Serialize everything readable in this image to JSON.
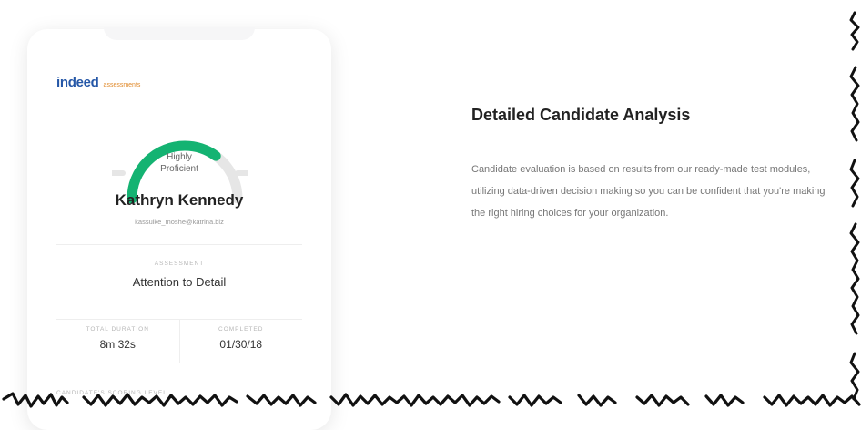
{
  "card": {
    "logo_brand": "indeed",
    "logo_sub": "assessments",
    "gauge_line1": "Highly",
    "gauge_line2": "Proficient",
    "gauge_level": 0.7,
    "gauge_color": "#14b372",
    "candidate_name": "Kathryn Kennedy",
    "candidate_email": "kassulke_moshe@katrina.biz",
    "assessment_label": "ASSESSMENT",
    "assessment_value": "Attention to Detail",
    "total_duration_label": "TOTAL DURATION",
    "total_duration_value": "8m 32s",
    "completed_label": "COMPLETED",
    "completed_value": "01/30/18",
    "scoring_label": "CANDIDATE'S SCORING LEVEL"
  },
  "feature": {
    "title": "Detailed Candidate Analysis",
    "description": "Candidate evaluation is based on results from our ready-made test modules, utilizing data-driven decision making so you can be confident that you're making the right hiring choices for your organization."
  }
}
